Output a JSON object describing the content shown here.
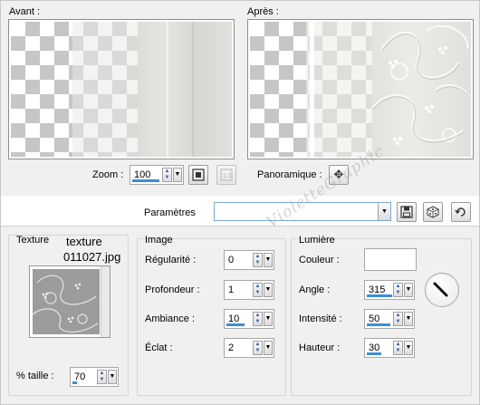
{
  "preview": {
    "before_label": "Avant :",
    "after_label": "Après :"
  },
  "zoom": {
    "label": "Zoom :",
    "value": "100"
  },
  "pan": {
    "label": "Panoramique :"
  },
  "params": {
    "label": "Paramètres",
    "value": ""
  },
  "texture": {
    "group_label": "Texture",
    "name_line1": "texture",
    "name_line2": "011027.jpg",
    "size_label": "% taille :",
    "size_value": "70"
  },
  "image": {
    "group_label": "Image",
    "fields": [
      {
        "label": "Régularité :",
        "value": "0"
      },
      {
        "label": "Profondeur :",
        "value": "1"
      },
      {
        "label": "Ambiance :",
        "value": "10"
      },
      {
        "label": "Éclat :",
        "value": "2"
      }
    ]
  },
  "light": {
    "group_label": "Lumière",
    "color_label": "Couleur :",
    "color": "#ffffff",
    "fields": [
      {
        "label": "Angle :",
        "value": "315"
      },
      {
        "label": "Intensité :",
        "value": "50"
      },
      {
        "label": "Hauteur :",
        "value": "30"
      }
    ]
  },
  "watermark": "VioletteGraphic",
  "colors": {
    "accent": "#3b8fd4",
    "dialog_bg": "#f0f0f0"
  }
}
